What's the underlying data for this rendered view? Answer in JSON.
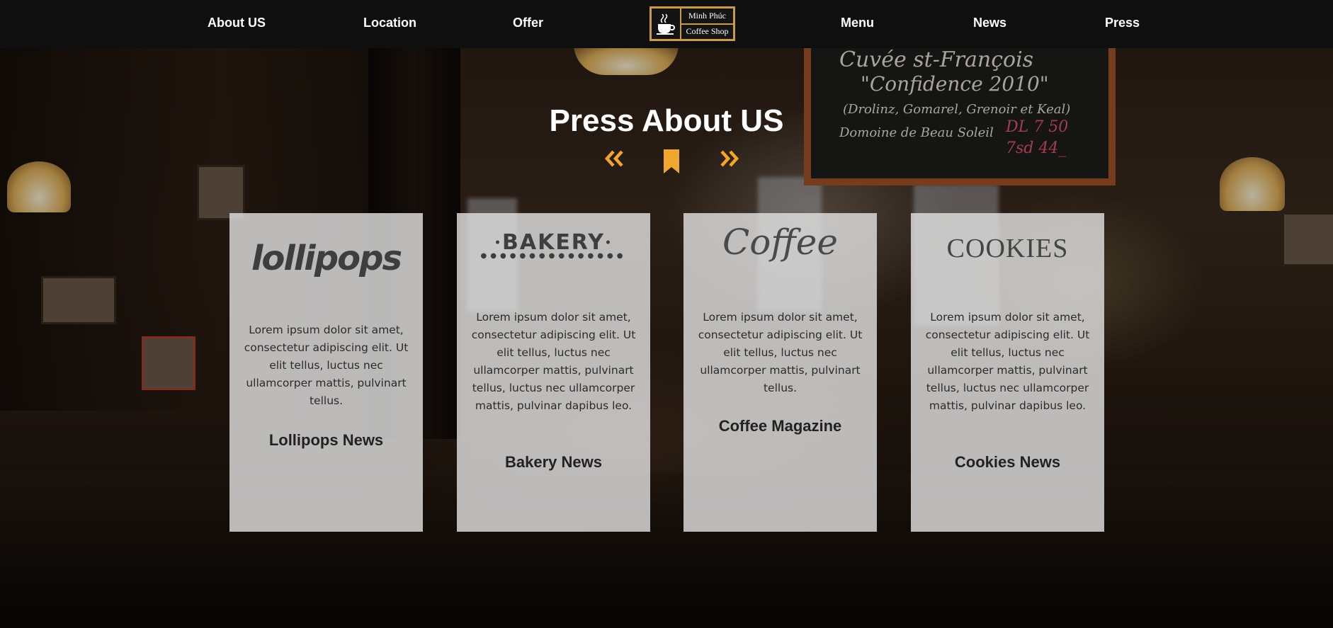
{
  "nav": {
    "items": [
      "About US",
      "Location",
      "Offer",
      "Menu",
      "News",
      "Press"
    ],
    "logo": {
      "line1": "Minh Phúc",
      "line2": "Coffee Shop"
    }
  },
  "section": {
    "title": "Press About US"
  },
  "cards": [
    {
      "brand": "lollipops",
      "text": "Lorem ipsum dolor sit amet, consectetur adipiscing elit. Ut elit tellus, luctus nec ullamcorper mattis, pulvinart tellus.",
      "title": "Lollipops News"
    },
    {
      "brand": "BAKERY",
      "text": "Lorem ipsum dolor sit amet, consectetur adipiscing elit. Ut elit tellus, luctus nec ullamcorper mattis, pulvinart tellus, luctus nec ullamcorper mattis, pulvinar dapibus leo.",
      "title": "Bakery News"
    },
    {
      "brand": "Coffee",
      "text": "Lorem ipsum dolor sit amet, consectetur adipiscing elit. Ut elit tellus, luctus nec ullamcorper mattis, pulvinart tellus.",
      "title": "Coffee Magazine"
    },
    {
      "brand": "COOKIES",
      "text": "Lorem ipsum dolor sit amet, consectetur adipiscing elit. Ut elit tellus, luctus nec ullamcorper mattis, pulvinart tellus, luctus nec ullamcorper mattis, pulvinar dapibus leo.",
      "title": "Cookies News"
    }
  ],
  "colors": {
    "accent": "#f0a72e",
    "logo_border": "#c99a4a",
    "nav_bg": "#0f0f0f"
  },
  "icons": {
    "prev": "double-chevron-left-icon",
    "bookmark": "bookmark-icon",
    "next": "double-chevron-right-icon",
    "logo": "coffee-cup-icon"
  }
}
